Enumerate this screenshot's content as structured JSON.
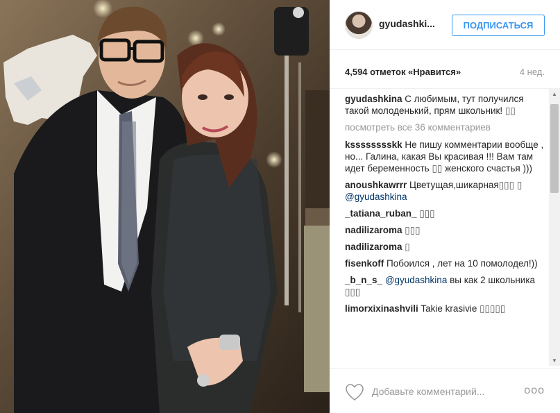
{
  "post": {
    "image_alt": "",
    "username": "gyudashki...",
    "follow_label": "ПОДПИСАТЬСЯ",
    "likes": "4,594 отметок «Нравится»",
    "timestamp": "4 нед."
  },
  "comments": [
    {
      "author": "gyudashkina",
      "text": "С любимым, тут получился такой молоденький, прям школьник!",
      "emoji": "▯▯"
    },
    {
      "view_all": "посмотреть все 36 комментариев"
    },
    {
      "author": "ksssssssskk",
      "text": "Не пишу комментарии вообще , но... Галина, какая Вы красивая !!! Вам там идет беременность",
      "emoji_mid": "▯▯",
      "text2": "женского счастья )))"
    },
    {
      "author": "anoushkawrrr",
      "text": "Цветущая,шикарная",
      "emoji": "▯▯▯",
      "emoji2": "▯",
      "mention": "@gyudashkina"
    },
    {
      "author": "_tatiana_ruban_",
      "emoji": "▯▯▯"
    },
    {
      "author": "nadilizaroma",
      "emoji": "▯▯▯"
    },
    {
      "author": "nadilizaroma",
      "emoji": "▯"
    },
    {
      "author": "fisenkoff",
      "text": "Побоился , лет на 10 помолодел!))"
    },
    {
      "author": "_b_n_s_",
      "mention": "@gyudashkina",
      "text": "вы как 2 школьника",
      "emoji": "▯▯▯"
    },
    {
      "author": "limorxixinashvili",
      "text": "Takie krasivie",
      "emoji": "▯▯▯▯▯"
    }
  ],
  "footer": {
    "comment_placeholder": "Добавьте комментарий...",
    "more_label": "ooo"
  },
  "icons": {
    "heart": "heart-icon",
    "more": "more-options-icon",
    "scroll_up": "scroll-up-arrow-icon",
    "scroll_down": "scroll-down-arrow-icon"
  },
  "colors": {
    "accent": "#3897f0",
    "text": "#262626",
    "muted": "#999999",
    "mention": "#003569"
  }
}
